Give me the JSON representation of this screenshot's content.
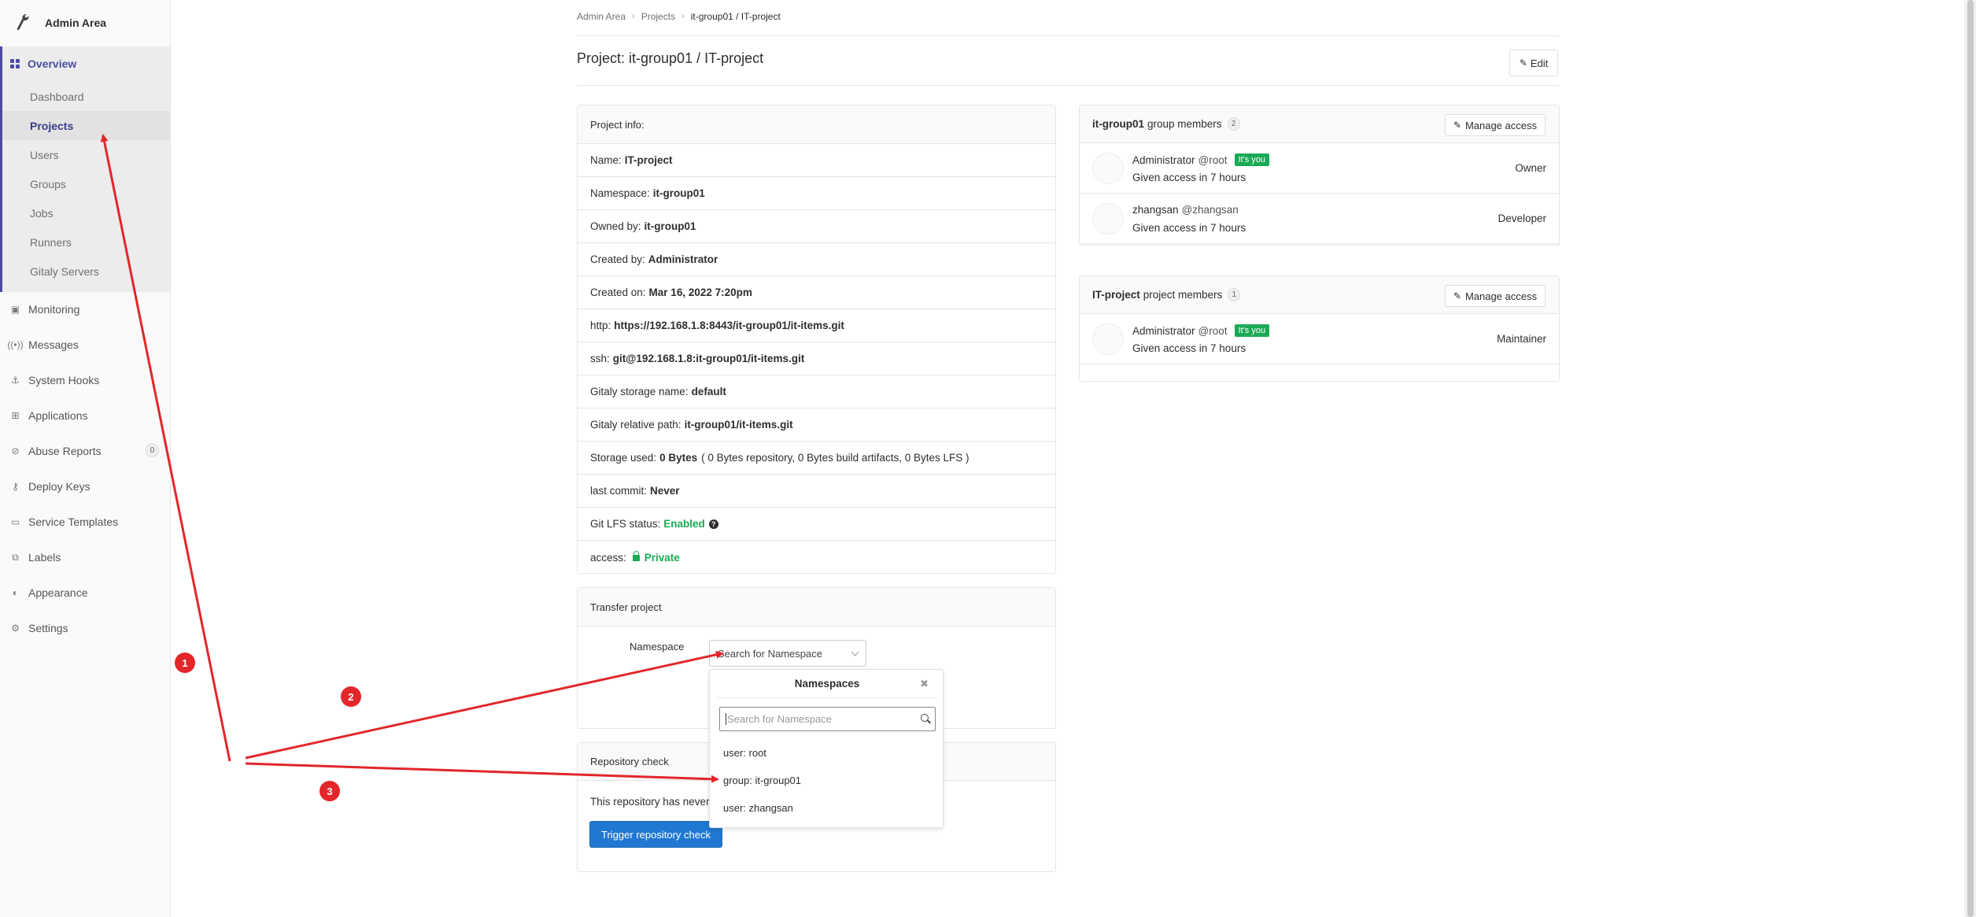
{
  "sidebar": {
    "title": "Admin Area",
    "overview_label": "Overview",
    "sub_items": [
      {
        "label": "Dashboard"
      },
      {
        "label": "Projects"
      },
      {
        "label": "Users"
      },
      {
        "label": "Groups"
      },
      {
        "label": "Jobs"
      },
      {
        "label": "Runners"
      },
      {
        "label": "Gitaly Servers"
      }
    ],
    "items": [
      {
        "label": "Monitoring",
        "icon": "monitor-icon"
      },
      {
        "label": "Messages",
        "icon": "broadcast-icon"
      },
      {
        "label": "System Hooks",
        "icon": "hook-icon"
      },
      {
        "label": "Applications",
        "icon": "grid-icon"
      },
      {
        "label": "Abuse Reports",
        "icon": "report-icon",
        "badge": "0"
      },
      {
        "label": "Deploy Keys",
        "icon": "key-icon"
      },
      {
        "label": "Service Templates",
        "icon": "template-icon"
      },
      {
        "label": "Labels",
        "icon": "label-icon"
      },
      {
        "label": "Appearance",
        "icon": "appearance-icon"
      },
      {
        "label": "Settings",
        "icon": "gear-icon"
      }
    ]
  },
  "breadcrumb": {
    "items": [
      "Admin Area",
      "Projects",
      "it-group01 / IT-project"
    ]
  },
  "header": {
    "title": "Project: it-group01 / IT-project",
    "edit_label": "Edit"
  },
  "project_info": {
    "heading": "Project info:",
    "rows": [
      {
        "label": "Name:",
        "value": "IT-project"
      },
      {
        "label": "Namespace:",
        "value": "it-group01"
      },
      {
        "label": "Owned by:",
        "value": "it-group01"
      },
      {
        "label": "Created by:",
        "value": "Administrator"
      },
      {
        "label": "Created on:",
        "value": "Mar 16, 2022 7:20pm"
      },
      {
        "label": "http:",
        "value": "https://192.168.1.8:8443/it-group01/it-items.git"
      },
      {
        "label": "ssh:",
        "value": "git@192.168.1.8:it-group01/it-items.git"
      },
      {
        "label": "Gitaly storage name:",
        "value": "default"
      },
      {
        "label": "Gitaly relative path:",
        "value": "it-group01/it-items.git"
      },
      {
        "label": "Storage used:",
        "value": "0 Bytes",
        "extra": "( 0 Bytes repository, 0 Bytes build artifacts, 0 Bytes LFS )"
      },
      {
        "label": "last commit:",
        "value": "Never"
      },
      {
        "label": "Git LFS status:",
        "value": "Enabled"
      },
      {
        "label": "access:",
        "value": "Private"
      }
    ]
  },
  "transfer": {
    "heading": "Transfer project",
    "namespace_label": "Namespace",
    "select_value": "Search for Namespace",
    "dropdown": {
      "title": "Namespaces",
      "search_placeholder": "Search for Namespace",
      "options": [
        "user: root",
        "group: it-group01",
        "user: zhangsan"
      ]
    }
  },
  "repo_check": {
    "heading": "Repository check",
    "text": "This repository has never",
    "button_label": "Trigger repository check"
  },
  "group_members": {
    "name": "it-group01",
    "suffix": "group members",
    "count": "2",
    "manage_label": "Manage access",
    "members": [
      {
        "name": "Administrator",
        "username": "@root",
        "badge": "It's you",
        "since": "Given access in 7 hours",
        "role": "Owner"
      },
      {
        "name": "zhangsan",
        "username": "@zhangsan",
        "badge": "",
        "since": "Given access in 7 hours",
        "role": "Developer"
      }
    ]
  },
  "project_members": {
    "name": "IT-project",
    "suffix": "project members",
    "count": "1",
    "manage_label": "Manage access",
    "members": [
      {
        "name": "Administrator",
        "username": "@root",
        "badge": "It's you",
        "since": "Given access in 7 hours",
        "role": "Maintainer"
      }
    ]
  },
  "annotations": {
    "markers": [
      "1",
      "2",
      "3"
    ],
    "color": "#e3262a"
  }
}
